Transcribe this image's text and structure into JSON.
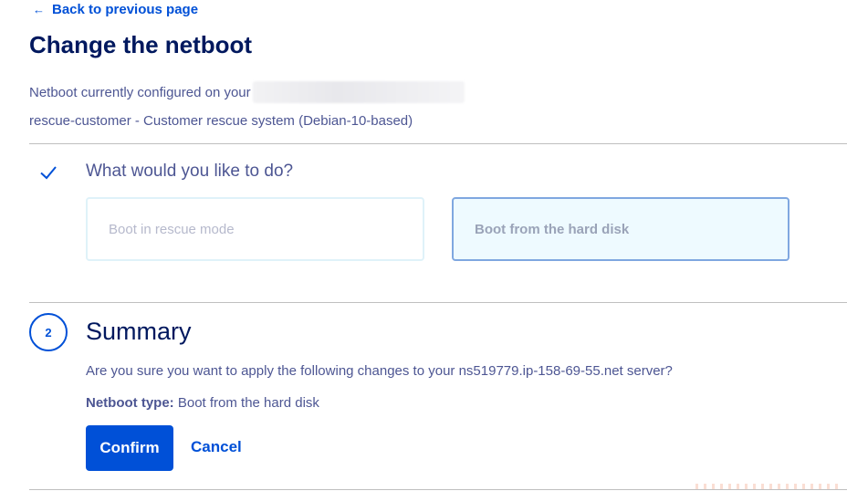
{
  "nav": {
    "back_label": "Back to previous page",
    "back_icon": "arrow-left-icon"
  },
  "page": {
    "title": "Change the netboot",
    "netboot_current_prefix": "Netboot currently configured on your",
    "netboot_current_value": "rescue-customer - Customer rescue system (Debian-10-based)"
  },
  "step1": {
    "status_icon": "check-icon",
    "title": "What would you like to do?",
    "options": [
      {
        "label": "Boot in rescue mode",
        "selected": false
      },
      {
        "label": "Boot from the hard disk",
        "selected": true
      }
    ]
  },
  "step2": {
    "number": "2",
    "title": "Summary",
    "question": "Are you sure you want to apply the following changes to your ns519779.ip-158-69-55.net server?",
    "netboot_type_label": "Netboot type:",
    "netboot_type_value": "Boot from the hard disk",
    "confirm_label": "Confirm",
    "cancel_label": "Cancel"
  },
  "colors": {
    "primary": "#0050d7",
    "heading": "#00185e",
    "text": "#4d5693",
    "selected_bg": "#eefaff",
    "selected_border": "#7fa7e0"
  }
}
